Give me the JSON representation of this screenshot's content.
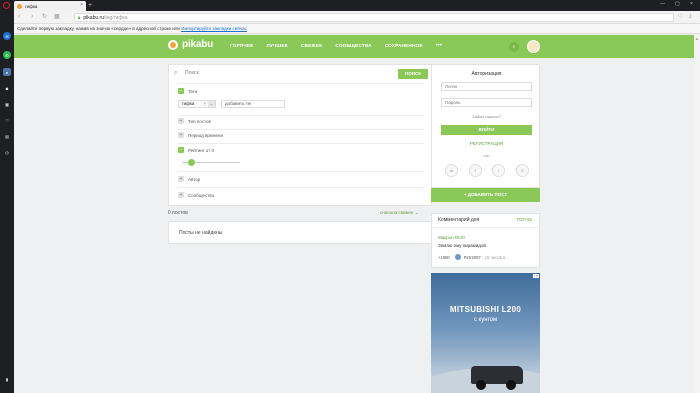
{
  "browser": {
    "tab_title": "гифка",
    "tab_close": "×",
    "new_tab": "+",
    "url_host": "pikabu.ru",
    "url_path": "/tag/гифка",
    "bookmark_prompt": "Сделайте первую закладку, нажав на значок «сердце» в адресной строке или",
    "bookmark_link": "Импортируйте закладки сейчас",
    "sidebar_icons": [
      "messenger-icon",
      "whatsapp-icon",
      "vk-icon",
      "camera-icon",
      "speed-dial-icon",
      "heart-icon",
      "news-icon",
      "history-icon"
    ]
  },
  "header": {
    "logo_text": "pikabu",
    "menu": [
      "ГОРЯЧЕЕ",
      "ЛУЧШЕЕ",
      "СВЕЖЕЕ",
      "СООБЩЕСТВА",
      "СОХРАНЕННОЕ"
    ],
    "more": "•••"
  },
  "filters": {
    "search_placeholder": "Поиск",
    "search_button": "ПОИСК",
    "tags_label": "Теги",
    "tag_chip": "гифка",
    "tag_input_placeholder": "добавить тег",
    "post_type": "Тип постов",
    "period": "Период времени",
    "rating": "Рейтинг от 0",
    "author": "Автор",
    "community": "Сообщество",
    "rating_value": 0
  },
  "results": {
    "count": "0 постов",
    "sort": "сначала свежее",
    "empty": "Посты не найдены"
  },
  "auth": {
    "title": "Авторизация",
    "login_placeholder": "Логин",
    "password_placeholder": "Пароль",
    "forgot": "Забыл пароль?",
    "login_button": "ВОЙТИ",
    "register": "РЕГИСТРАЦИЯ",
    "or": "или",
    "socials": [
      "vk-icon",
      "facebook-icon",
      "twitter-icon",
      "google-icon"
    ]
  },
  "add_post": "+ ДОБАВИТЬ ПОСТ",
  "comment_of_day": {
    "title": "Комментарий дня",
    "top": "ТОП 50",
    "post": "Макрон ВСЁ!",
    "text": "Землю ему пирамидой.",
    "rating": "+1880",
    "user": "Petr2087",
    "time": "15 часов н..."
  },
  "ad": {
    "title": "MITSUBISHI L200",
    "subtitle": "с кунгом",
    "mark": "i ×"
  },
  "colors": {
    "brand_green": "#8ac858",
    "link_green": "#5ea03a",
    "logo_orange": "#f2a33a"
  }
}
